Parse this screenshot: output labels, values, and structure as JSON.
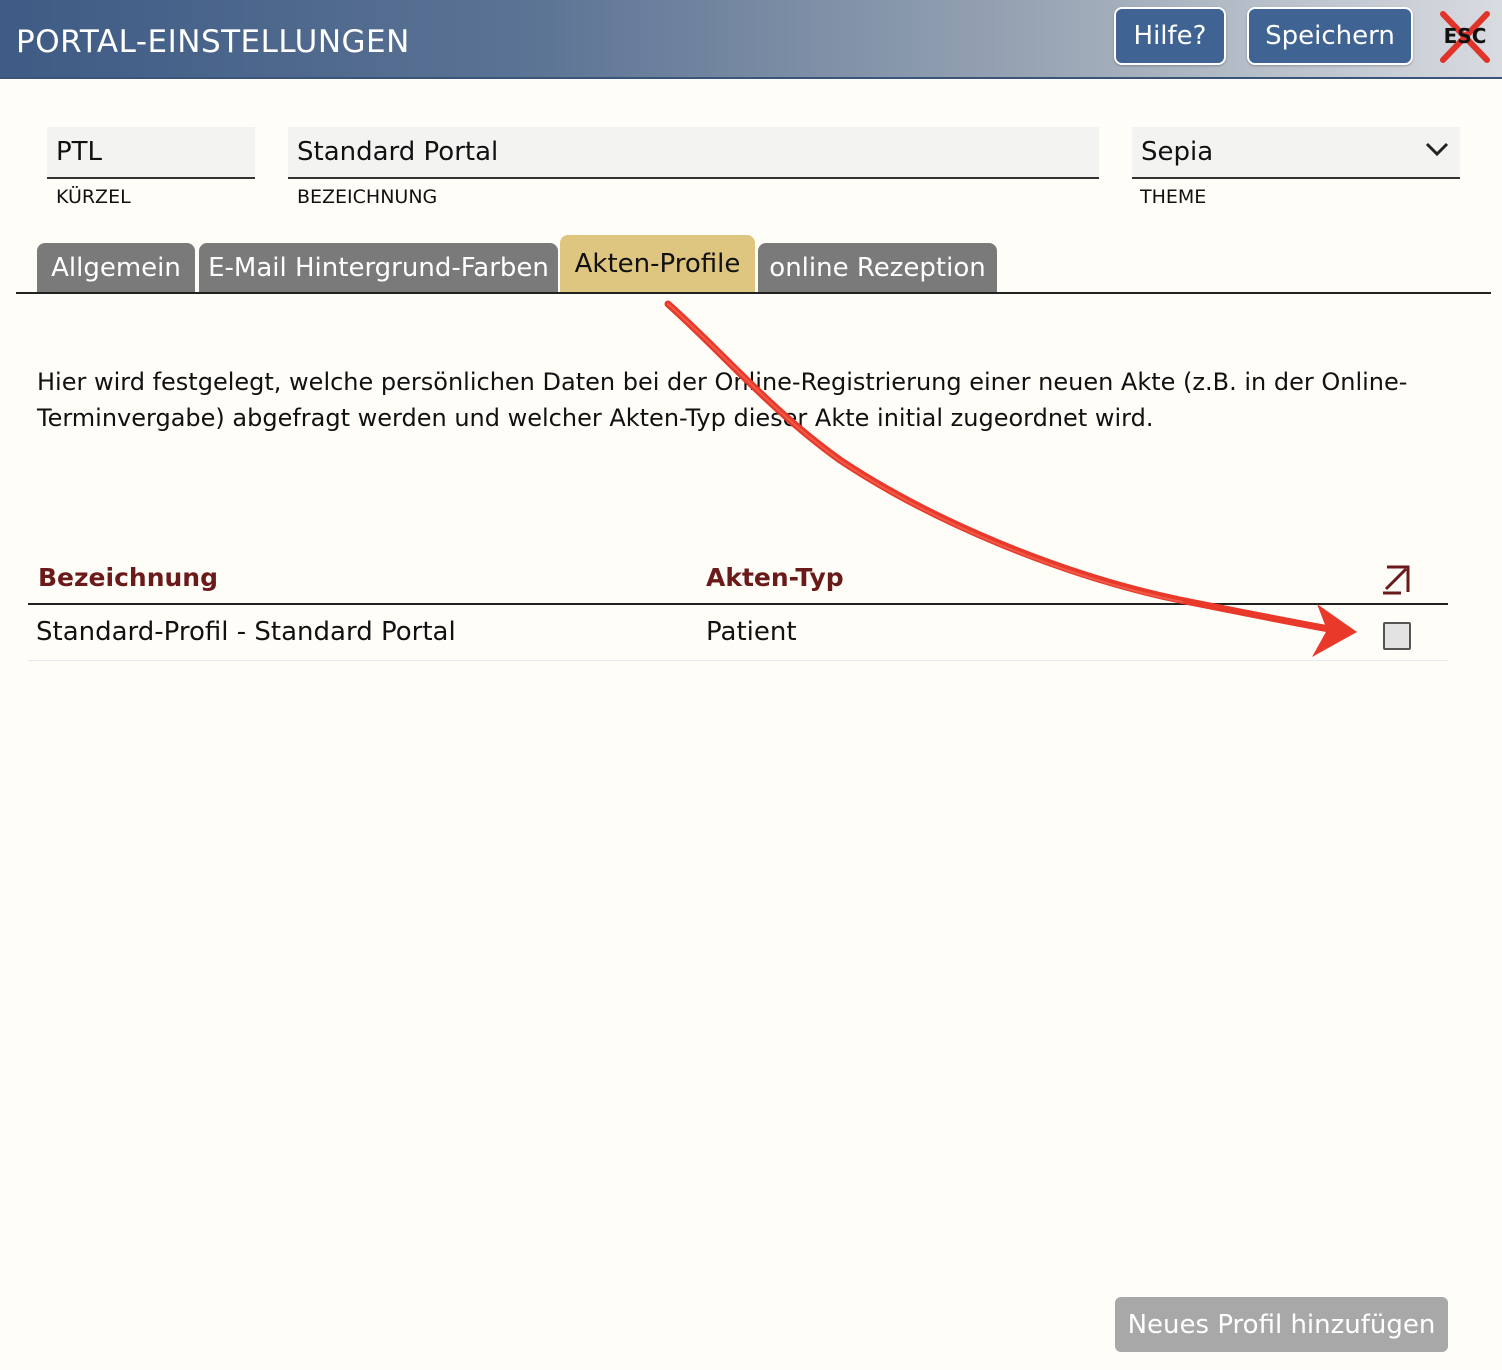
{
  "header": {
    "title": "PORTAL-EINSTELLUNGEN",
    "help_label": "Hilfe?",
    "save_label": "Speichern",
    "esc_label": "ESC"
  },
  "fields": {
    "kuerzel": {
      "value": "PTL",
      "label": "KÜRZEL"
    },
    "bezeichnung": {
      "value": "Standard Portal",
      "label": "BEZEICHNUNG"
    },
    "theme": {
      "value": "Sepia",
      "label": "THEME"
    }
  },
  "tabs": [
    {
      "label": "Allgemein",
      "active": false
    },
    {
      "label": "E-Mail Hintergrund-Farben",
      "active": false
    },
    {
      "label": "Akten-Profile",
      "active": true
    },
    {
      "label": "online Rezeption",
      "active": false
    }
  ],
  "description": "Hier wird festgelegt, welche persönlichen Daten bei der Online-Registrierung einer neuen Akte (z.B. in der Online-Terminvergabe) abgefragt werden und welcher Akten-Typ dieser Akte initial zugeordnet wird.",
  "table": {
    "columns": [
      "Bezeichnung",
      "Akten-Typ"
    ],
    "rows": [
      {
        "bezeichnung": "Standard-Profil - Standard Portal",
        "akten_typ": "Patient",
        "checked": false
      }
    ]
  },
  "footer": {
    "add_label": "Neues Profil hinzufügen"
  },
  "colors": {
    "header_accent": "#3f6393",
    "active_tab": "#dec580",
    "inactive_tab": "#7a7a7a",
    "column_header": "#6b1a1a",
    "annotation": "#e8392a"
  }
}
